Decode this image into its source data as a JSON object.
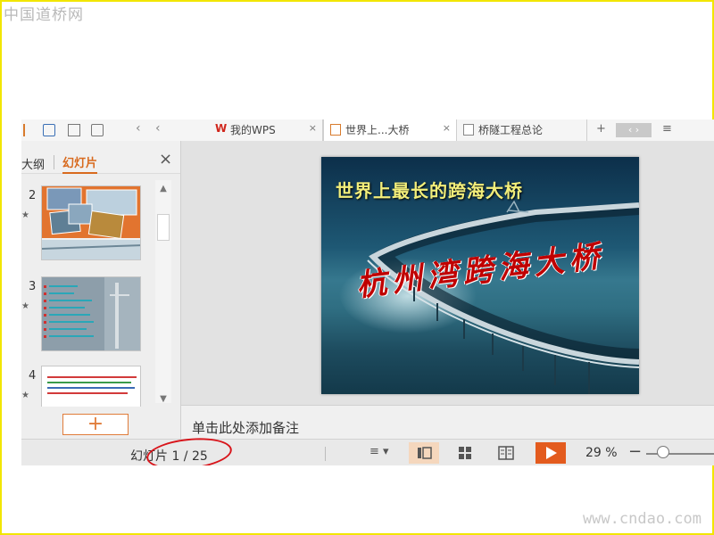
{
  "watermarks": {
    "top": "中国道桥网",
    "bottom": "www.cndao.com"
  },
  "tabs": [
    {
      "label": "我的WPS",
      "icon": "wps-icon",
      "close": "×"
    },
    {
      "label": "世界上...大桥",
      "icon": "presentation-doc-icon",
      "close": "×"
    },
    {
      "label": "桥隧工程总论",
      "icon": "document-icon",
      "close": ""
    }
  ],
  "tabstrip": {
    "back_chevron": "‹",
    "new_tab": "+",
    "menu": "≡"
  },
  "panel": {
    "tab_outline": "大纲",
    "tab_slides": "幻灯片",
    "close": "×",
    "add_button": "+"
  },
  "thumbnails": [
    {
      "number": "2",
      "star": "★"
    },
    {
      "number": "3",
      "star": "★"
    },
    {
      "number": "4",
      "star": "★"
    }
  ],
  "slide": {
    "title": "世界上最长的跨海大桥",
    "subtitle": "杭州湾跨海大桥"
  },
  "notes": {
    "placeholder": "单击此处添加备注"
  },
  "status": {
    "slide_counter": "幻灯片 1 / 25",
    "zoom": "29 %",
    "zoom_minus": "−"
  },
  "colors": {
    "accent": "#d86a1e",
    "play": "#e35b1e",
    "highlight_ring": "#d8141a",
    "frame": "#f2e600"
  }
}
